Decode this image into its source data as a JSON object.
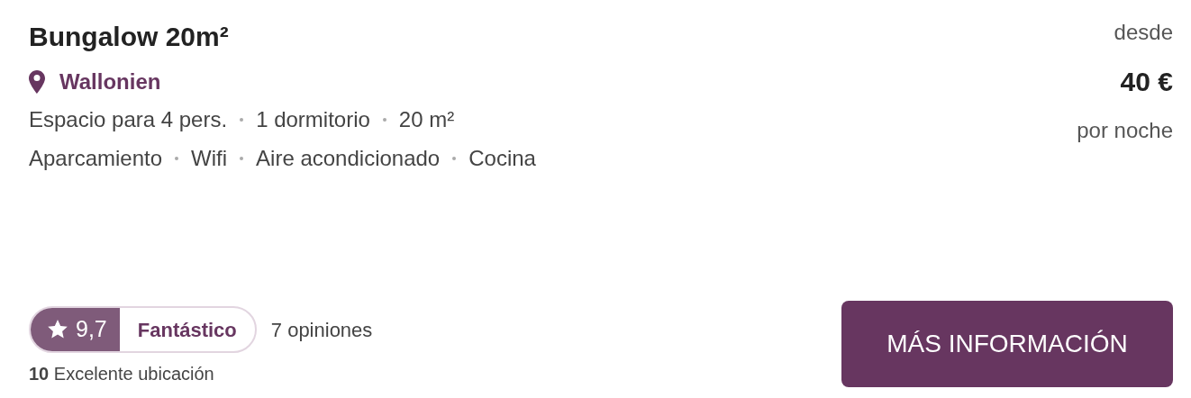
{
  "title": "Bungalow 20m²",
  "location": "Wallonien",
  "features": [
    [
      "Espacio para 4 pers.",
      "1 dormitorio",
      "20 m²"
    ],
    [
      "Aparcamiento",
      "Wifi",
      "Aire acondicionado",
      "Cocina"
    ]
  ],
  "rating": {
    "score": "9,7",
    "label": "Fantástico",
    "reviews": "7 opiniones"
  },
  "sub_rating": "**10** Excelente ubicación",
  "price": {
    "prefix": "desde",
    "amount": "40 €",
    "suffix": "por noche"
  },
  "button": "MÁS INFORMACIÓN"
}
